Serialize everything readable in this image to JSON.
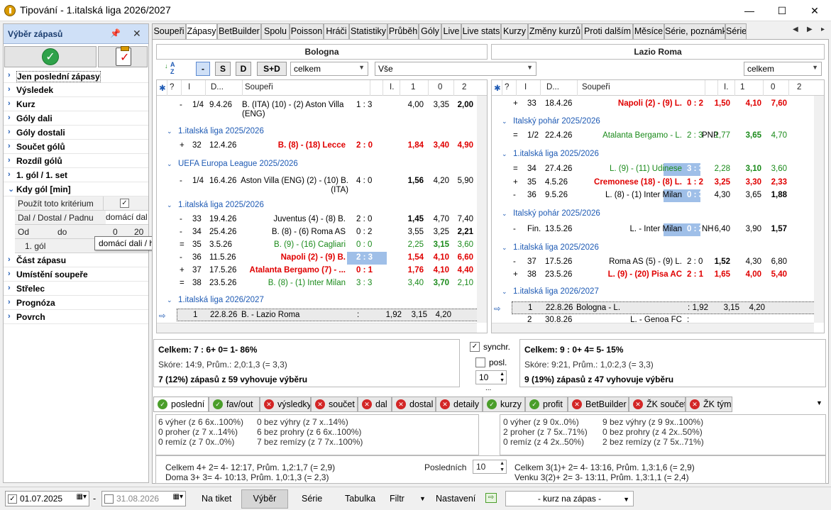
{
  "window": {
    "title": "Tipování - 1.italská liga 2026/2027",
    "min": "—",
    "max": "☐",
    "close": "✕"
  },
  "left": {
    "title": "Výběr zápasů",
    "items": [
      "Jen poslední zápasy",
      "Výsledek",
      "Kurz",
      "Góly dali",
      "Góly dostali",
      "Součet gólů",
      "Rozdíl gólů",
      "1. gól / 1. set",
      "Kdy gól [min]",
      "Část zápasu",
      "Umístění soupeře",
      "Střelec",
      "Prognóza",
      "Povrch"
    ],
    "sub": {
      "use": "Použít toto kritérium",
      "dal": "Dal / Dostal / Padnu",
      "dal_val": "domácí dal",
      "od": "Od",
      "do": "do",
      "od_val": "0",
      "do_val": "20",
      "first_goal": "1. gól",
      "tooltip": "domácí dali / hosté dostali"
    }
  },
  "tabs": [
    "Soupeři",
    "Zápasy",
    "BetBuilder",
    "Spolu",
    "Poisson",
    "Hráči",
    "Statistiky",
    "Průběh",
    "Góly",
    "Live",
    "Live stats",
    "Kurzy",
    "Změny kurzů",
    "Proti dalším",
    "Měsíce",
    "Série, poznámky",
    "Série"
  ],
  "teams": {
    "home": "Bologna",
    "away": "Lazio Roma"
  },
  "toolbar": {
    "b1": "-",
    "b2": "S",
    "b3": "D",
    "b4": "S+D",
    "combo1": "celkem",
    "combo2": "Vše",
    "combo3": "celkem"
  },
  "grid_head": {
    "star": "✱",
    "q": "?",
    "i": "I",
    "date": "D...",
    "opp": "Soupeři",
    "i2": "I.",
    "c1": "1",
    "c0": "0",
    "c2": "2"
  },
  "left_rows": [
    {
      "type": "m",
      "s": "-",
      "r": "1/4",
      "d": "9.4.26",
      "t": "B. (ITA) (10) - (2) Aston Villa (ENG)",
      "sc": "1 : 3",
      "o1": "4,00",
      "o0": "3,35",
      "o2": "2,00",
      "b2": true
    },
    {
      "type": "g",
      "t": "1.italská liga 2025/2026"
    },
    {
      "type": "m",
      "s": "+",
      "r": "32",
      "d": "12.4.26",
      "t": "B. (8) - (18) Lecce",
      "sc": "2 : 0",
      "o1": "1,84",
      "o0": "3,40",
      "o2": "4,90",
      "red": true
    },
    {
      "type": "g",
      "t": "UEFA Europa League 2025/2026"
    },
    {
      "type": "m",
      "s": "-",
      "r": "1/4",
      "d": "16.4.26",
      "t": "Aston Villa (ENG) (2) - (10) B. (ITA)",
      "sc": "4 : 0",
      "o1": "1,56",
      "o0": "4,20",
      "o2": "5,90",
      "b1": true
    },
    {
      "type": "g",
      "t": "1.italská liga 2025/2026"
    },
    {
      "type": "m",
      "s": "-",
      "r": "33",
      "d": "19.4.26",
      "t": "Juventus (4) - (8) B.",
      "sc": "2 : 0",
      "o1": "1,45",
      "o0": "4,70",
      "o2": "7,40",
      "b1": true
    },
    {
      "type": "m",
      "s": "-",
      "r": "34",
      "d": "25.4.26",
      "t": "B. (8) - (6) Roma AS",
      "sc": "0 : 2",
      "o1": "3,55",
      "o0": "3,25",
      "o2": "2,21",
      "b2": true
    },
    {
      "type": "m",
      "s": "=",
      "r": "35",
      "d": "3.5.26",
      "t": "B. (9) - (16) Cagliari",
      "sc": "0 : 0",
      "o1": "2,25",
      "o0": "3,15",
      "o2": "3,60",
      "green": true
    },
    {
      "type": "m",
      "s": "-",
      "r": "36",
      "d": "11.5.26",
      "t": "Napoli (2) - (9) B.",
      "sc": "2 : 3",
      "o1": "1,54",
      "o0": "4,10",
      "o2": "6,60",
      "red": true,
      "hl": true
    },
    {
      "type": "m",
      "s": "+",
      "r": "37",
      "d": "17.5.26",
      "t": "Atalanta Bergamo (7) - ...",
      "sc": "0 : 1",
      "o1": "1,76",
      "o0": "4,10",
      "o2": "4,40",
      "red": true
    },
    {
      "type": "m",
      "s": "=",
      "r": "38",
      "d": "23.5.26",
      "t": "B. (8) - (1) Inter Milan",
      "sc": "3 : 3",
      "o1": "3,40",
      "o0": "3,70",
      "o2": "2,10",
      "green": true
    },
    {
      "type": "g",
      "t": "1.italská liga 2026/2027"
    },
    {
      "type": "m",
      "s": "",
      "r": "1",
      "d": "22.8.26",
      "t": "B. - Lazio Roma",
      "sc": ":",
      "o1": "1,92",
      "o0": "3,15",
      "o2": "4,20",
      "cur": true
    }
  ],
  "right_rows": [
    {
      "type": "m",
      "s": "+",
      "r": "33",
      "d": "18.4.26",
      "t": "Napoli (2) - (9) L.",
      "sc": "0 : 2",
      "o1": "1,50",
      "o0": "4,10",
      "o2": "7,60",
      "red": true
    },
    {
      "type": "g",
      "t": "Italský pohár 2025/2026"
    },
    {
      "type": "m",
      "s": "=",
      "r": "1/2",
      "d": "22.4.26",
      "t": "Atalanta Bergamo - L.",
      "sc": "2 : 3",
      "x": "PNP",
      "o1": "1,77",
      "o0": "3,65",
      "o2": "4,70",
      "green": true
    },
    {
      "type": "g",
      "t": "1.italská liga 2025/2026"
    },
    {
      "type": "m",
      "s": "=",
      "r": "34",
      "d": "27.4.26",
      "t": "L. (9) - (11) Udinese",
      "sc": "3 : 3",
      "o1": "2,28",
      "o0": "3,10",
      "o2": "3,60",
      "green": true,
      "hl": true
    },
    {
      "type": "m",
      "s": "+",
      "r": "35",
      "d": "4.5.26",
      "t": "Cremonese (18) - (8) L.",
      "sc": "1 : 2",
      "o1": "3,25",
      "o0": "3,30",
      "o2": "2,33",
      "red": true
    },
    {
      "type": "m",
      "s": "-",
      "r": "36",
      "d": "9.5.26",
      "t": "L. (8) - (1) Inter Milan",
      "sc": "0 : 3",
      "o1": "4,30",
      "o0": "3,65",
      "o2": "1,88",
      "b2": true,
      "hl": true
    },
    {
      "type": "g",
      "t": "Italský pohár 2025/2026"
    },
    {
      "type": "m",
      "s": "-",
      "r": "Fin.",
      "d": "13.5.26",
      "t": "L. - Inter Milan",
      "sc": "0 : 2",
      "x": "NH",
      "o1": "6,40",
      "o0": "3,90",
      "o2": "1,57",
      "b2": true,
      "hl": true
    },
    {
      "type": "g",
      "t": "1.italská liga 2025/2026"
    },
    {
      "type": "m",
      "s": "-",
      "r": "37",
      "d": "17.5.26",
      "t": "Roma AS (5) - (9) L.",
      "sc": "2 : 0",
      "o1": "1,52",
      "o0": "4,30",
      "o2": "6,80",
      "b1": true
    },
    {
      "type": "m",
      "s": "+",
      "r": "38",
      "d": "23.5.26",
      "t": "L. (9) - (20) Pisa AC",
      "sc": "2 : 1",
      "o1": "1,65",
      "o0": "4,00",
      "o2": "5,40",
      "red": true
    },
    {
      "type": "g",
      "t": "1.italská liga 2026/2027"
    },
    {
      "type": "m",
      "s": "",
      "r": "1",
      "d": "22.8.26",
      "t": "Bologna - L.",
      "sc": ":",
      "o1": "1,92",
      "o0": "3,15",
      "o2": "4,20",
      "cur": true
    },
    {
      "type": "m",
      "s": "",
      "r": "2",
      "d": "30.8.26",
      "t": "L. - Genoa FC",
      "sc": ":",
      "o1": "",
      "o0": "",
      "o2": ""
    }
  ],
  "summary_left": {
    "l1": "Celkem: 7 : 6+  0=  1-  86%",
    "l2": "Skóre: 14:9, Prům.: 2,0:1,3 (= 3,3)",
    "l3": "7 (12%) zápasů z 59 vyhovuje výběru"
  },
  "summary_right": {
    "l1": "Celkem: 9 : 0+  4=  5-  15%",
    "l2": "Skóre: 9:21, Prům.: 1,0:2,3 (= 3,3)",
    "l3": "9 (19%) zápasů z 47 vyhovuje výběru"
  },
  "sync": {
    "synchr": "synchr.",
    "posl": "posl.",
    "val": "10",
    "dots": "..."
  },
  "bottom_tabs": [
    {
      "label": "poslední",
      "ok": true
    },
    {
      "label": "fav/out",
      "ok": true
    },
    {
      "label": "výsledky",
      "ok": false
    },
    {
      "label": "součet",
      "ok": false
    },
    {
      "label": "dal",
      "ok": false
    },
    {
      "label": "dostal",
      "ok": false
    },
    {
      "label": "detaily",
      "ok": false
    },
    {
      "label": "kurzy",
      "ok": true
    },
    {
      "label": "profit",
      "ok": true
    },
    {
      "label": "BetBuilder",
      "ok": false
    },
    {
      "label": "ŽK součet",
      "ok": false
    },
    {
      "label": "ŽK tým",
      "ok": false
    }
  ],
  "stats_left": {
    "a": [
      "6 výher (z 6 6x..100%)",
      "0 proher (z 7 x..14%)",
      "0 remíz (z 7 0x..0%)"
    ],
    "b": [
      "0 bez výhry (z 7 x..14%)",
      "6 bez prohry (z 6 6x..100%)",
      "7 bez remízy (z 7 7x..100%)"
    ]
  },
  "stats_right": {
    "a": [
      "0 výher (z 9 0x..0%)",
      "2 proher (z 7 5x..71%)",
      "0 remíz (z 4 2x..50%)"
    ],
    "b": [
      "9 bez výhry (z 9 9x..100%)",
      "0 bez prohry (z 4 2x..50%)",
      "2 bez remízy (z 7 5x..71%)"
    ]
  },
  "last": {
    "l1": "Celkem 4+   2=   4-   12:17,  Prům. 1,2:1,7 (= 2,9)",
    "l2": "Doma   3+   3=   4-   10:13,  Prům. 1,0:1,3 (= 2,3)",
    "posl": "Posledních",
    "val": "10",
    "r1": "Celkem    3(1)+  2=   4-   13:16,  Prům. 1,3:1,6 (= 2,9)",
    "r2": "Venku     3(2)+  2=   3-   13:11,  Prům. 1,3:1,1 (= 2,4)"
  },
  "status": {
    "date_from": "01.07.2025",
    "date_to": "31.08.2026",
    "ticket": "Na tiket",
    "vyber": "Výběr",
    "serie": "Série",
    "tabulka": "Tabulka",
    "filtr": "Filtr",
    "nastaveni": "Nastavení",
    "kurz": "- kurz na zápas -"
  }
}
